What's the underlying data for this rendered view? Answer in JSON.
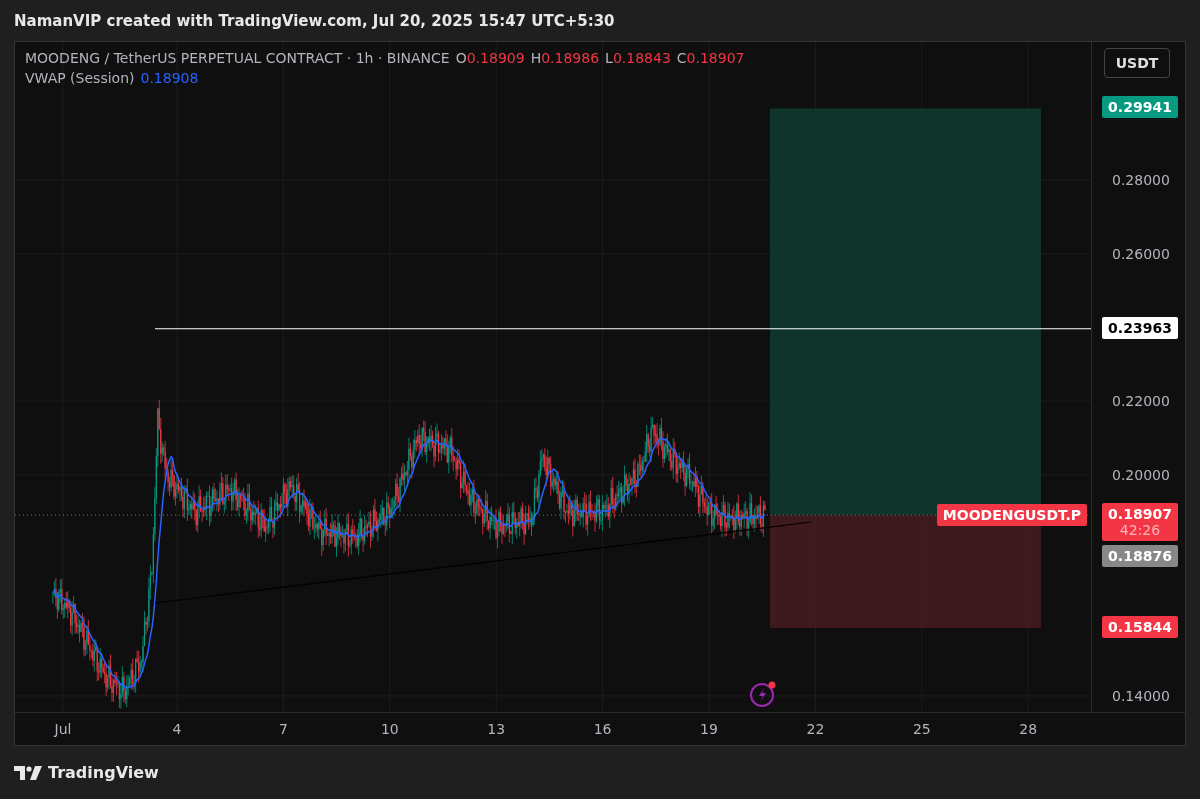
{
  "header": {
    "text": "NamanVIP created with TradingView.com, Jul 20, 2025 15:47 UTC+5:30"
  },
  "legend": {
    "title": "MOODENG / TetherUS PERPETUAL CONTRACT · 1h · BINANCE",
    "ohlc": [
      {
        "label": "O",
        "value": "0.18909"
      },
      {
        "label": "H",
        "value": "0.18986"
      },
      {
        "label": "L",
        "value": "0.18843"
      },
      {
        "label": "C",
        "value": "0.18907"
      }
    ],
    "vwap": {
      "label": "VWAP (Session)",
      "value": "0.18908"
    }
  },
  "currency_button": "USDT",
  "price_axis": {
    "ticks": [
      "0.28000",
      "0.26000",
      "0.22000",
      "0.20000",
      "0.14000"
    ],
    "labels": [
      {
        "kind": "target",
        "value": "0.29941"
      },
      {
        "kind": "line",
        "value": "0.23963"
      },
      {
        "kind": "last",
        "value": "0.18907",
        "countdown": "42:26"
      },
      {
        "kind": "vwap",
        "value": "0.18876"
      },
      {
        "kind": "stop",
        "value": "0.15844"
      }
    ]
  },
  "symbol_tag": "MOODENGUSDT.P",
  "time_axis": [
    "Jul",
    "4",
    "7",
    "10",
    "13",
    "16",
    "19",
    "22",
    "25",
    "28"
  ],
  "footer": {
    "logo_text": "TradingView"
  }
}
